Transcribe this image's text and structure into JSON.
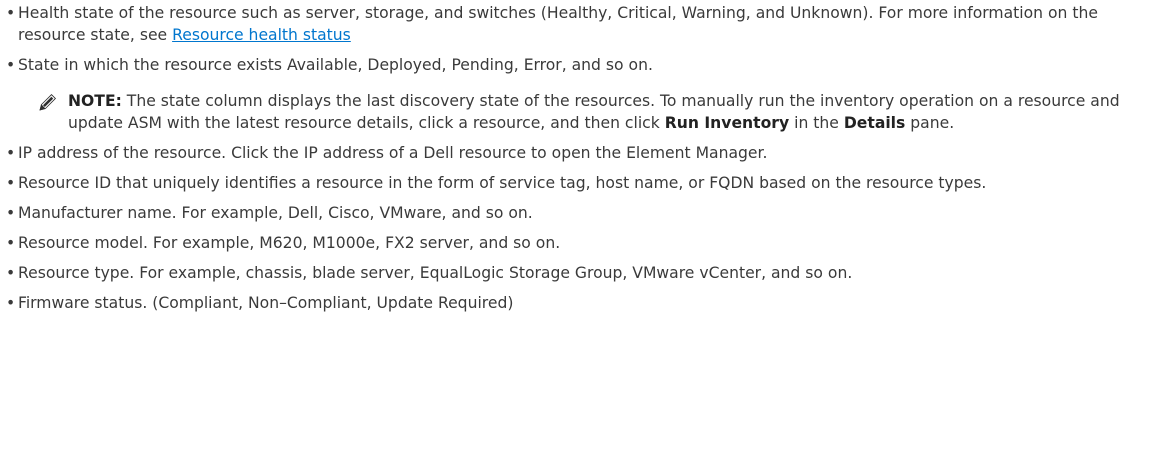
{
  "bullet_char": "•",
  "items": [
    {
      "text": "Health state of the resource such as server, storage, and switches (Healthy, Critical, Warning, and Unknown). For more information on the resource state, see ",
      "link": "Resource health status"
    },
    {
      "text": "State in which the resource exists Available, Deployed, Pending, Error, and so on."
    },
    {
      "text": "IP address of the resource. Click the IP address of a Dell resource to open the Element Manager."
    },
    {
      "text": "Resource ID that uniquely identifies a resource in the form of service tag, host name, or FQDN based on the resource types."
    },
    {
      "text": "Manufacturer name. For example, Dell, Cisco, VMware, and so on."
    },
    {
      "text": "Resource model. For example, M620, M1000e, FX2 server, and so on."
    },
    {
      "text": "Resource type. For example, chassis, blade server, EqualLogic Storage Group, VMware vCenter, and so on."
    },
    {
      "text": "Firmware status. (Compliant, Non–Compliant, Update Required)"
    }
  ],
  "note": {
    "label": "NOTE:",
    "text_1": " The state column displays the last discovery state of the resources. To manually run the inventory operation on a resource and update ASM with the latest resource details, click a resource, and then click ",
    "bold_1": "Run Inventory",
    "text_2": " in the ",
    "bold_2": "Details",
    "text_3": " pane.",
    "icon": "pencil-note-icon"
  }
}
